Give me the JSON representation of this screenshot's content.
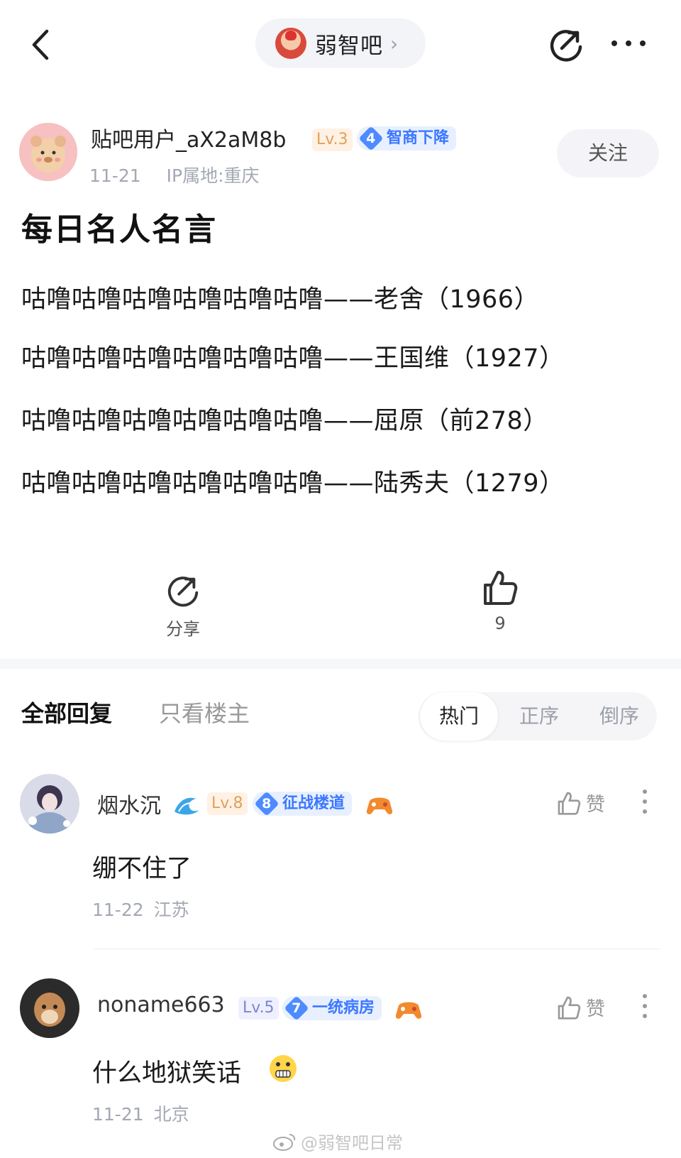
{
  "topbar": {
    "forum_name": "弱智吧",
    "chevron": "›",
    "icons": [
      "back-icon",
      "share-icon",
      "more-icon"
    ]
  },
  "post": {
    "author": {
      "name": "贴吧用户_aX2aM8b",
      "level": "Lv.3",
      "title_num": "4",
      "title": "智商下降",
      "date": "11-21",
      "ip": "IP属地:重庆"
    },
    "follow_label": "关注",
    "title": "每日名人名言",
    "lines": [
      "咕噜咕噜咕噜咕噜咕噜咕噜——老舍（1966）",
      "咕噜咕噜咕噜咕噜咕噜咕噜——王国维（1927）",
      "咕噜咕噜咕噜咕噜咕噜咕噜——屈原（前278）",
      "咕噜咕噜咕噜咕噜咕噜咕噜——陆秀夫（1279）"
    ],
    "share_label": "分享",
    "like_count": "9"
  },
  "replies": {
    "tab_all": "全部回复",
    "tab_op": "只看楼主",
    "sort": [
      "热门",
      "正序",
      "倒序"
    ],
    "like_label": "赞",
    "items": [
      {
        "name": "烟水沉",
        "level": "Lv.8",
        "title_num": "8",
        "title": "征战楼道",
        "text": "绷不住了",
        "date": "11-22",
        "location": "江苏"
      },
      {
        "name": "noname663",
        "level": "Lv.5",
        "title_num": "7",
        "title": "一统病房",
        "text": "什么地狱笑话",
        "date": "11-21",
        "location": "北京"
      }
    ]
  },
  "watermark": "@弱智吧日常",
  "colors": {
    "accent_blue": "#3b78ff",
    "meta_gray": "#a3a8b3",
    "level_orange": "#e0a05c"
  }
}
